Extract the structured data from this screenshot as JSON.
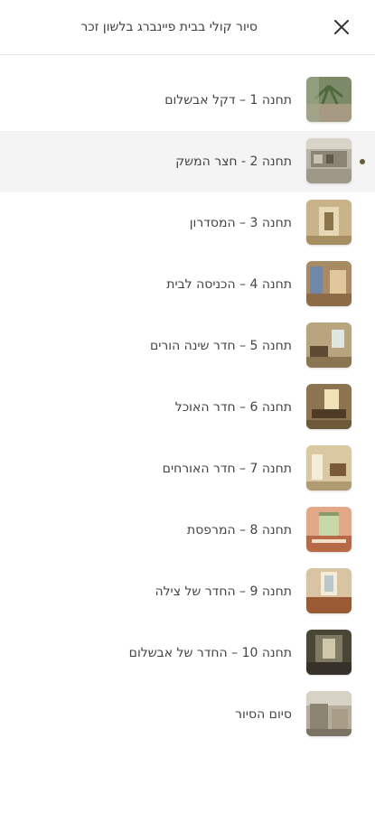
{
  "header": {
    "title": "סיור קולי בבית פיינברג בלשון זכר",
    "close_icon": "close-icon"
  },
  "colors": {
    "active_row_bg": "#f4f4f4",
    "active_dot": "#6b5a3a"
  },
  "stops": [
    {
      "label": "תחנה 1 – דקל אבשלום",
      "active": false
    },
    {
      "label": "תחנה 2 - חצר המשק",
      "active": true
    },
    {
      "label": "תחנה 3 – המסדרון",
      "active": false
    },
    {
      "label": "תחנה 4 – הכניסה לבית",
      "active": false
    },
    {
      "label": "תחנה 5 – חדר שינה הורים",
      "active": false
    },
    {
      "label": "תחנה 6 – חדר האוכל",
      "active": false
    },
    {
      "label": "תחנה 7 – חדר האורחים",
      "active": false
    },
    {
      "label": "תחנה 8 – המרפסת",
      "active": false
    },
    {
      "label": "תחנה 9 – החדר של צילה",
      "active": false
    },
    {
      "label": "תחנה 10 – החדר של אבשלום",
      "active": false
    },
    {
      "label": "סיום הסיור",
      "active": false
    }
  ]
}
